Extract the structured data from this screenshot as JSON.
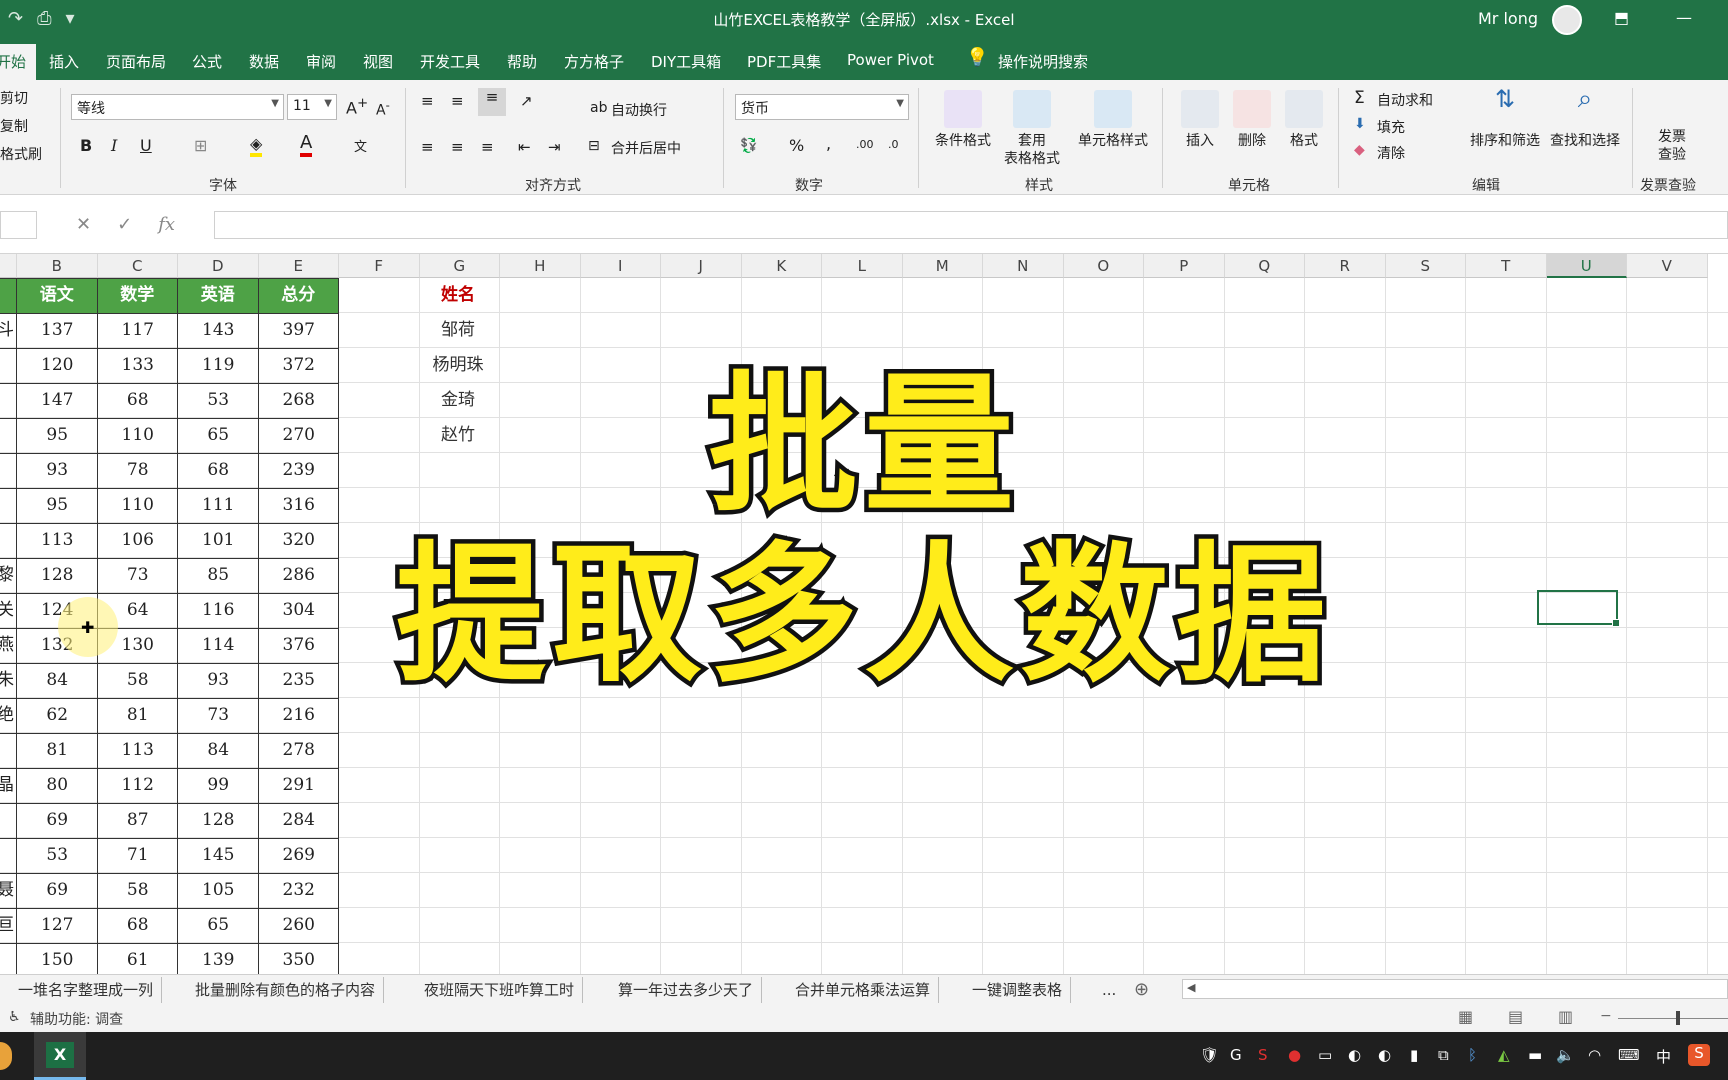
{
  "window": {
    "title": "山竹EXCEL表格教学（全屏版）.xlsx  -  Excel",
    "user": "Mr long"
  },
  "ribbon_tabs": [
    "开始",
    "插入",
    "页面布局",
    "公式",
    "数据",
    "审阅",
    "视图",
    "开发工具",
    "帮助",
    "方方格子",
    "DIY工具箱",
    "PDF工具集",
    "Power Pivot",
    "操作说明搜索"
  ],
  "clipboard": {
    "cut": "剪切",
    "copy": "复制",
    "format_painter": "格式刷"
  },
  "font": {
    "name": "等线",
    "size": "11",
    "group_label": "字体"
  },
  "alignment": {
    "wrap": "自动换行",
    "merge": "合并后居中",
    "group_label": "对齐方式"
  },
  "number": {
    "format": "货币",
    "group_label": "数字"
  },
  "styles": {
    "conditional": "条件格式",
    "table_format": "套用\n表格格式",
    "cell_styles": "单元格样式",
    "group_label": "样式"
  },
  "cells": {
    "insert": "插入",
    "delete": "删除",
    "format": "格式",
    "group_label": "单元格"
  },
  "editing": {
    "autosum": "自动求和",
    "fill": "填充",
    "clear": "清除",
    "sort": "排序和筛选",
    "find": "查找和选择",
    "group_label": "编辑"
  },
  "invoice": {
    "check": "发票\n查验",
    "group_label": "发票查验"
  },
  "formula_bar": {
    "fx": "fx"
  },
  "columns": [
    "B",
    "C",
    "D",
    "E",
    "F",
    "G",
    "H",
    "I",
    "J",
    "K",
    "L",
    "M",
    "N",
    "O",
    "P",
    "Q",
    "R",
    "S",
    "T",
    "U",
    "V"
  ],
  "selected_column": "U",
  "table": {
    "headers": [
      "语文",
      "数学",
      "英语",
      "总分"
    ],
    "row_stubs": [
      "斗",
      "",
      "",
      "",
      "",
      "",
      "",
      "黎",
      "关",
      "燕",
      "朱",
      "绝",
      "",
      "晶",
      "",
      "",
      "聂",
      "亘"
    ],
    "rows": [
      [
        "137",
        "117",
        "143",
        "397"
      ],
      [
        "120",
        "133",
        "119",
        "372"
      ],
      [
        "147",
        "68",
        "53",
        "268"
      ],
      [
        "95",
        "110",
        "65",
        "270"
      ],
      [
        "93",
        "78",
        "68",
        "239"
      ],
      [
        "95",
        "110",
        "111",
        "316"
      ],
      [
        "113",
        "106",
        "101",
        "320"
      ],
      [
        "128",
        "73",
        "85",
        "286"
      ],
      [
        "124",
        "64",
        "116",
        "304"
      ],
      [
        "132",
        "130",
        "114",
        "376"
      ],
      [
        "84",
        "58",
        "93",
        "235"
      ],
      [
        "62",
        "81",
        "73",
        "216"
      ],
      [
        "81",
        "113",
        "84",
        "278"
      ],
      [
        "80",
        "112",
        "99",
        "291"
      ],
      [
        "69",
        "87",
        "128",
        "284"
      ],
      [
        "53",
        "71",
        "145",
        "269"
      ],
      [
        "69",
        "58",
        "105",
        "232"
      ],
      [
        "127",
        "68",
        "65",
        "260"
      ],
      [
        "150",
        "61",
        "139",
        "350"
      ]
    ]
  },
  "lookup": {
    "header": "姓名",
    "names": [
      "邹荷",
      "杨明珠",
      "金琦",
      "赵竹"
    ]
  },
  "overlay": {
    "line1": "批量",
    "line2": "提取多人数据"
  },
  "ime": {
    "mode": "中",
    "punct": "°,"
  },
  "sheet_tabs": [
    "一堆名字整理成一列",
    "批量删除有颜色的格子内容",
    "夜班隔天下班咋算工时",
    "算一年过去多少天了",
    "合并单元格乘法运算",
    "一键调整表格"
  ],
  "sheet_tabs_more": "...",
  "status": {
    "accessibility": "辅助功能: 调查"
  },
  "taskbar": {
    "ime": "中"
  }
}
